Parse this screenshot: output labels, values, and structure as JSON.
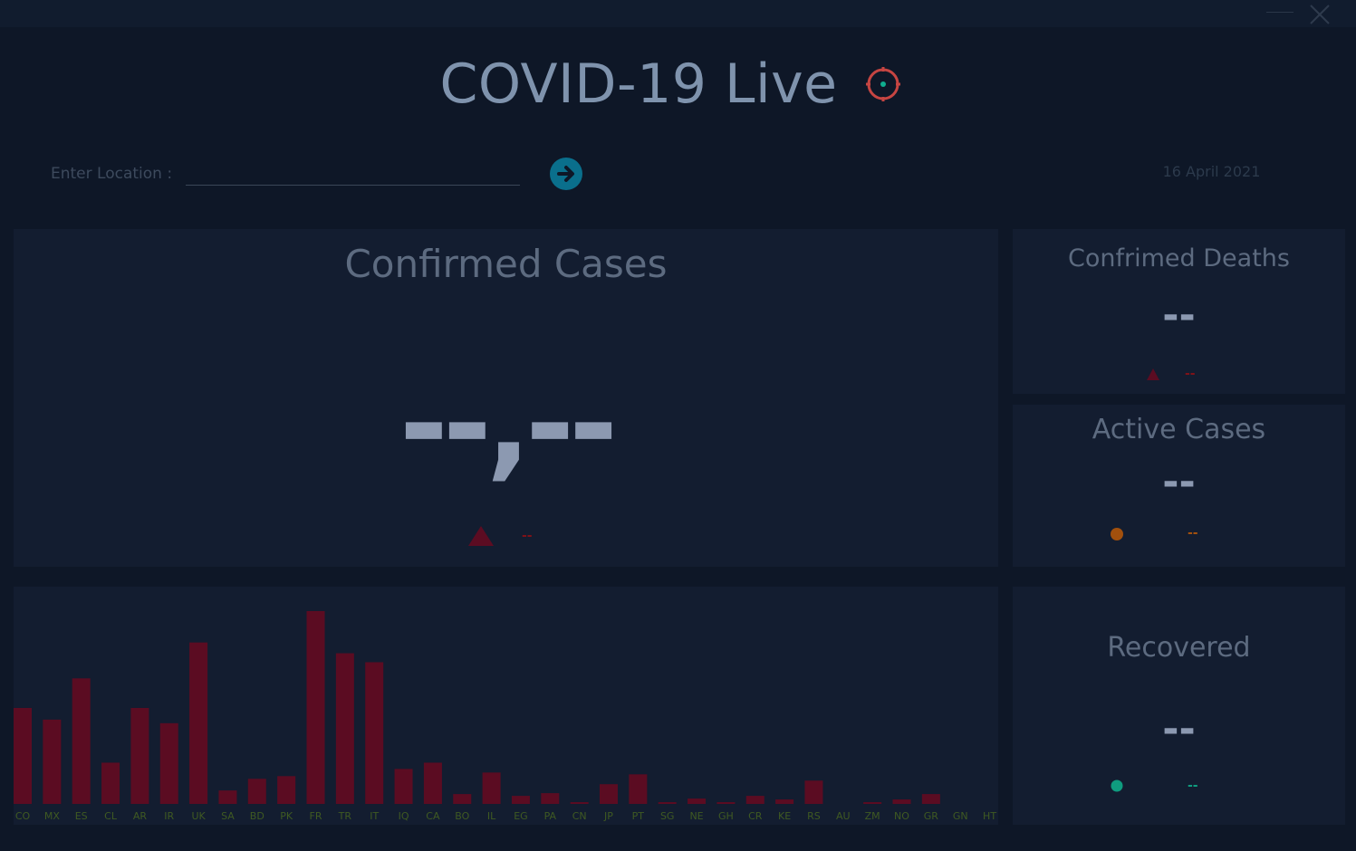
{
  "window": {
    "minimize_icon": "minimize-icon",
    "close_icon": "close-icon"
  },
  "header": {
    "title": "COVID-19 Live",
    "locate_icon": "locate-target-icon"
  },
  "search": {
    "label": "Enter Location :",
    "value": "",
    "placeholder": "",
    "go_icon": "arrow-right-icon"
  },
  "date": "16 April 2021",
  "cards": {
    "confirmed": {
      "title": "Confirmed Cases",
      "value": "--,--",
      "delta": "--",
      "marker": "triangle-up",
      "color": "#5b0c22"
    },
    "deaths": {
      "title": "Confrimed Deaths",
      "value": "--",
      "delta": "--",
      "marker": "triangle-up",
      "color": "#5b0c22",
      "delta_color": "#7e1218"
    },
    "active": {
      "title": "Active Cases",
      "value": "--",
      "delta": "--",
      "marker": "circle",
      "color": "#a2500d"
    },
    "recovered": {
      "title": "Recovered",
      "value": "--",
      "delta": "--",
      "marker": "circle",
      "color": "#0f9c7f"
    }
  },
  "colors": {
    "bar": "#5b0c22",
    "tick_label": "#3f5a22",
    "value_text": "#8c99b1"
  },
  "chart_data": {
    "type": "bar",
    "categories": [
      "CO",
      "MX",
      "ES",
      "CL",
      "AR",
      "IR",
      "UK",
      "SA",
      "BD",
      "PK",
      "FR",
      "TR",
      "IT",
      "IQ",
      "CA",
      "BO",
      "IL",
      "EG",
      "PA",
      "CN",
      "JP",
      "PT",
      "SG",
      "NE",
      "GH",
      "CR",
      "KE",
      "RS",
      "AU",
      "ZM",
      "NO",
      "GR",
      "GN",
      "HT"
    ],
    "values": [
      107,
      94,
      140,
      46,
      107,
      90,
      180,
      15,
      28,
      31,
      215,
      168,
      158,
      39,
      46,
      11,
      35,
      9,
      12,
      2,
      22,
      33,
      2,
      6,
      2,
      9,
      5,
      26,
      0,
      2,
      5,
      11,
      0,
      0
    ],
    "ylim": [
      0,
      215
    ],
    "grid": false
  }
}
